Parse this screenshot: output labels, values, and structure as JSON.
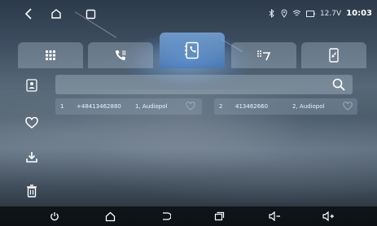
{
  "status_bar": {
    "battery_voltage": "12.7V",
    "clock": "10:03",
    "icons": [
      "back-icon",
      "home-outline-icon",
      "recent-square-icon",
      "bluetooth-icon",
      "location-icon",
      "wifi-icon",
      "battery-icon"
    ]
  },
  "tabs": [
    {
      "name": "apps-grid-icon",
      "active": false
    },
    {
      "name": "call-log-icon",
      "active": false
    },
    {
      "name": "contacts-book-icon",
      "active": true
    },
    {
      "name": "dialpad-icon",
      "active": false
    },
    {
      "name": "phone-link-icon",
      "active": false
    }
  ],
  "sidebar": {
    "items": [
      "contact-card-icon",
      "favorite-heart-icon",
      "download-icon",
      "delete-trash-icon"
    ]
  },
  "search": {
    "placeholder": "",
    "value": ""
  },
  "contacts": [
    {
      "index": "1",
      "number": "+48413462880",
      "name": "1, Audiopol"
    },
    {
      "index": "2",
      "number": "413462660",
      "name": "2, Audiopol"
    }
  ],
  "bottom_nav": [
    "power-icon",
    "home-icon",
    "back-icon",
    "recent-apps-icon",
    "volume-down-icon",
    "volume-up-icon"
  ],
  "colors": {
    "active_tab": "#4f8fd8",
    "text": "#e8eef4",
    "nav_bar": "#0a0e12"
  }
}
